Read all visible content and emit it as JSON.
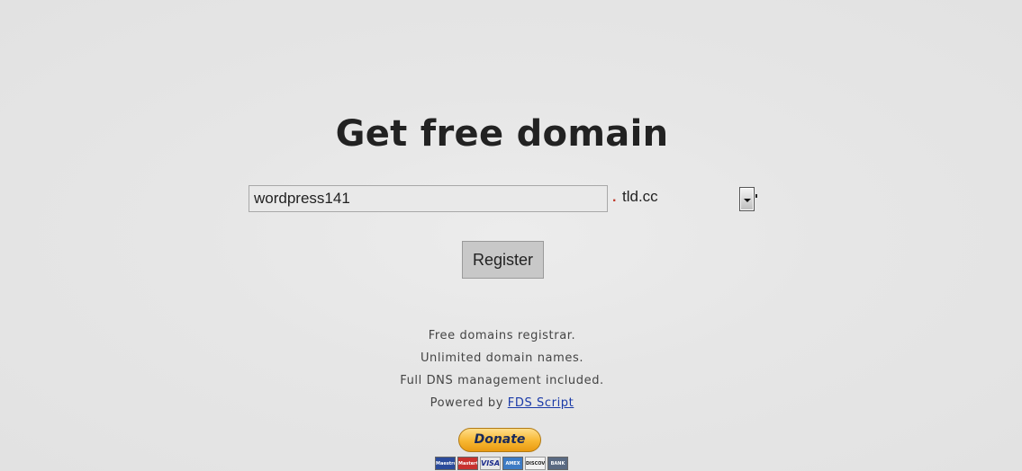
{
  "page": {
    "title": "Get free domain"
  },
  "form": {
    "domain_value": "wordpress141",
    "separator": ".",
    "tld_selected": "tld.cc",
    "register_label": "Register"
  },
  "info": {
    "line1": "Free domains registrar.",
    "line2": "Unlimited domain names.",
    "line3": "Full DNS management included.",
    "line4_prefix": "Powered by ",
    "line4_link": "FDS Script"
  },
  "donate": {
    "label": "Donate",
    "cards": [
      {
        "name": "maestro-card-icon",
        "label": "Maestro"
      },
      {
        "name": "mastercard-icon",
        "label": "MasterCard"
      },
      {
        "name": "visa-card-icon",
        "label": "VISA"
      },
      {
        "name": "amex-card-icon",
        "label": "AMEX"
      },
      {
        "name": "discover-card-icon",
        "label": "DISCOVER"
      },
      {
        "name": "bank-icon",
        "label": "BANK"
      }
    ]
  },
  "colors": {
    "background": "#e6e6e6",
    "title": "#222222",
    "link": "#1a3aa8",
    "donate_button": "#f7b731",
    "separator_dot": "#c0392b"
  }
}
